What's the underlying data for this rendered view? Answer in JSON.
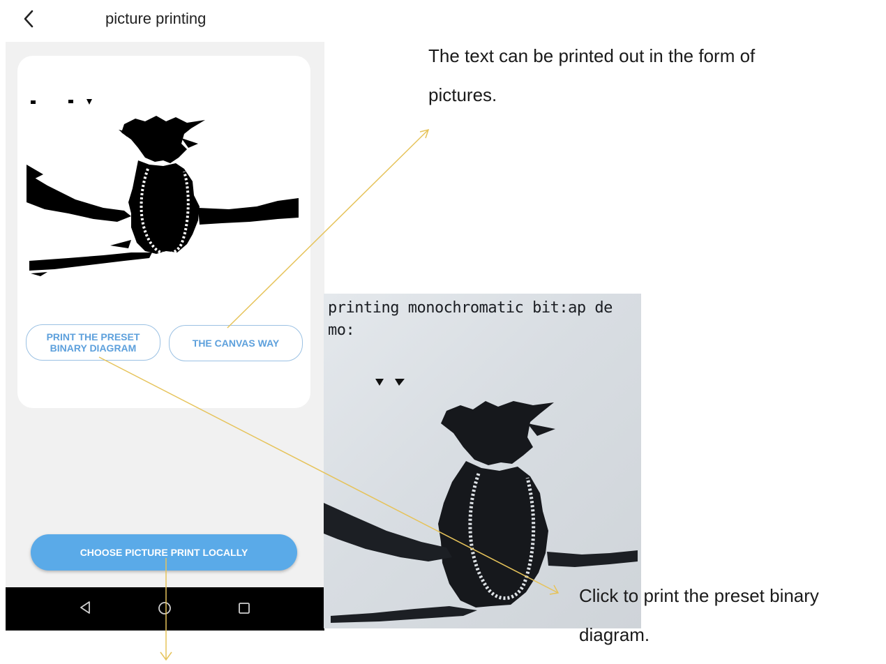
{
  "app": {
    "title": "picture printing",
    "back_icon": "chevron-left-icon"
  },
  "buttons": {
    "print_preset": "PRINT THE PRESET BINARY DIAGRAM",
    "canvas_way": "THE CANVAS WAY",
    "choose_local": "CHOOSE PICTURE PRINT LOCALLY"
  },
  "navbar": {
    "back_icon": "triangle-back-icon",
    "home_icon": "circle-home-icon",
    "recents_icon": "square-recents-icon"
  },
  "printed_receipt": {
    "line1": "printing monochromatic bit:ap de",
    "line2": "mo:"
  },
  "annotations": {
    "canvas_note": "The text can be printed out in the form of pictures.",
    "preset_note_line1": "Click to print the preset binary",
    "preset_note_line2": "diagram."
  },
  "colors": {
    "accent_blue": "#5aaae8",
    "pill_text": "#5da0dc",
    "arrow_yellow": "#e6c35a",
    "screen_bg": "#f1f1f1",
    "navbar_bg": "#000000"
  }
}
